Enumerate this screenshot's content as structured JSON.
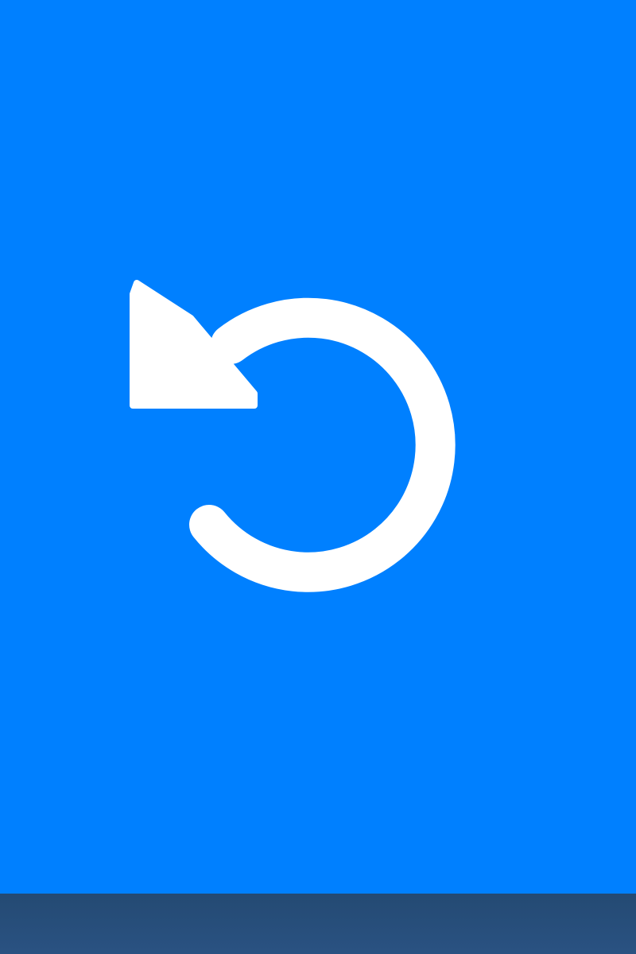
{
  "undo_button": {
    "icon": "undo-icon",
    "background_color": "#0080FF",
    "icon_color": "#FFFFFF"
  },
  "bottom_strip": {
    "color": "#284E7C"
  }
}
